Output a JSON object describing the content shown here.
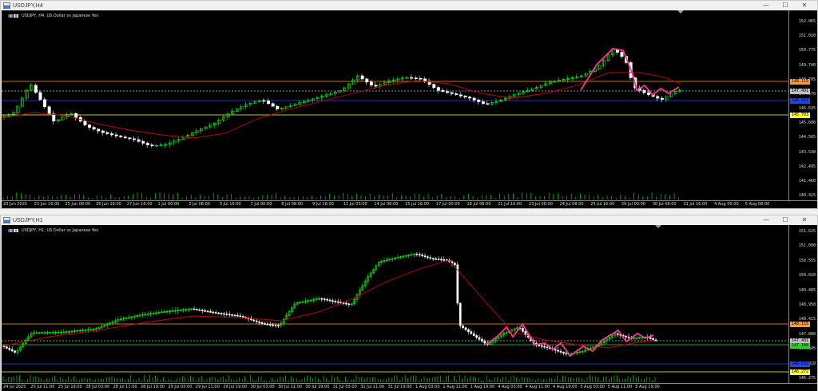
{
  "windows": [
    {
      "id": "h4",
      "title": "USDJPY,H4",
      "symbol_info": "USDJPY, H4:  US Dollar vs Japanese Yen",
      "price_labels": [
        "152.065",
        "151.010",
        "150.775",
        "149.740",
        "148.705",
        "147.670",
        "146.635",
        "145.600",
        "144.565",
        "143.530",
        "142.495",
        "141.460",
        "140.425"
      ],
      "price_tags": [
        {
          "text": "148.115",
          "color": "#ff9933"
        },
        {
          "text": "147.401",
          "color": "#c0c0c0"
        },
        {
          "text": "146.632",
          "color": "#2244ff"
        },
        {
          "text": "145.703",
          "color": "#ffff33"
        }
      ],
      "time_labels": [
        "20 Jun 2025",
        "23 Jun 16:00",
        "25 Jun 08:00",
        "26 Jun 16:00",
        "27 Jun 16:00",
        "1 Jul 00:00",
        "2 Jul 08:00",
        "3 Jul 16:00",
        "7 Jul 00:00",
        "8 Jul 08:00",
        "9 Jul 16:00",
        "11 Jul 00:00",
        "14 Jul 08:00",
        "15 Jul 16:00",
        "17 Jul 00:00",
        "18 Jul 08:00",
        "21 Jul 16:00",
        "23 Jul 00:00",
        "24 Jul 08:00",
        "25 Jul 16:00",
        "29 Jul 00:00",
        "30 Jul 08:00",
        "31 Jul 16:00",
        "4 Aug 00:00",
        "5 Aug 08:00"
      ]
    },
    {
      "id": "h1",
      "title": "USDJPY,H1",
      "symbol_info": "USDJPY, H1:  US Dollar vs Japanese Yen",
      "price_labels": [
        "151.625",
        "151.090",
        "150.555",
        "150.020",
        "149.485",
        "148.950",
        "148.415",
        "147.880",
        "147.345",
        "146.810",
        "146.275"
      ],
      "price_tags": [
        {
          "text": "148.115",
          "color": "#ff9933"
        },
        {
          "text": "147.401",
          "color": "#c0c0c0"
        },
        {
          "text": "147.188",
          "color": "#33cc33"
        },
        {
          "text": "146.632",
          "color": "#2244ff"
        },
        {
          "text": "146.272",
          "color": "#ffff33"
        }
      ],
      "time_labels": [
        "24 Jul 2025",
        "25 Jul 11:00",
        "25 Jul 19:00",
        "28 Jul 03:00",
        "28 Jul 11:00",
        "28 Jul 19:00",
        "29 Jul 03:00",
        "29 Jul 11:00",
        "29 Jul 19:00",
        "30 Jul 03:00",
        "30 Jul 11:00",
        "30 Jul 19:00",
        "31 Jul 03:00",
        "31 Jul 11:00",
        "31 Jul 19:00",
        "1 Aug 03:00",
        "1 Aug 11:00",
        "1 Aug 19:00",
        "4 Aug 03:00",
        "4 Aug 11:00",
        "4 Aug 19:00",
        "5 Aug 03:00",
        "5 Aug 11:00",
        "5 Aug 19:00"
      ]
    }
  ],
  "window_buttons": {
    "minimize": "—",
    "maximize": "☐",
    "close": "✕"
  },
  "colors": {
    "bull": "#00ff00",
    "bear": "#ffffff",
    "ma": "#cc0000",
    "zigzag": "#ff3399",
    "orange": "#ff9933",
    "blue": "#2244ff",
    "yellow": "#ffff33",
    "gray": "#c0c0c0",
    "green": "#33cc33"
  }
}
